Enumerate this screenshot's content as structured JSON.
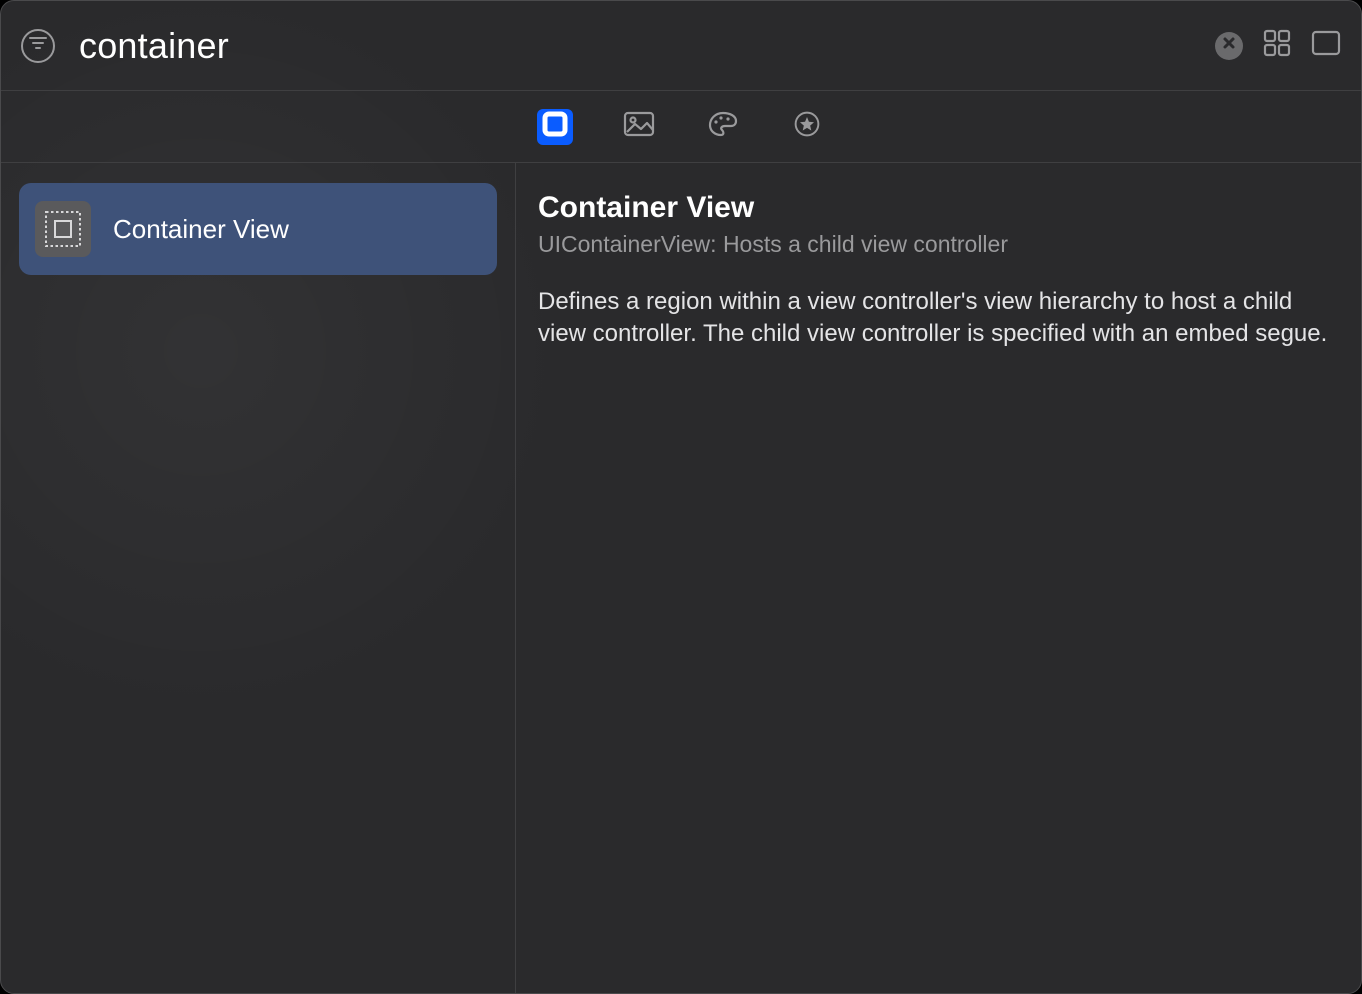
{
  "header": {
    "search_value": "container"
  },
  "categories": {
    "objects_active": true
  },
  "sidebar": {
    "items": [
      {
        "label": "Container View"
      }
    ]
  },
  "detail": {
    "title": "Container View",
    "subtitle": "UIContainerView: Hosts a child view controller",
    "description": "Defines a region within a view controller's view hierarchy to host a child view controller. The child view controller is specified with an embed segue."
  }
}
